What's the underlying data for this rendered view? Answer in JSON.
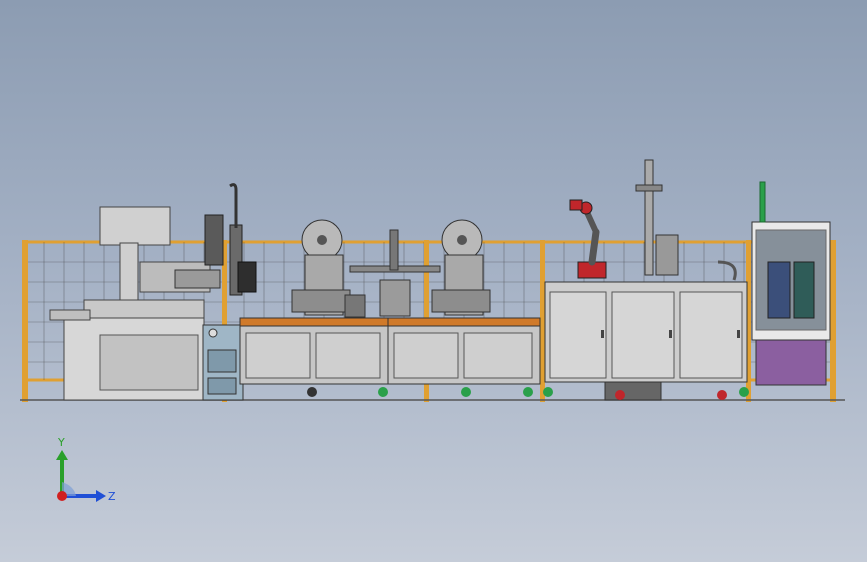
{
  "viewport": {
    "background_top": "#8c9cb2",
    "background_bottom": "#c5ccd8"
  },
  "model": {
    "fence_color": "#e0a032",
    "frame_color": "#b8b8b8",
    "cabinet_color": "#c9c9c9",
    "robot_accent": "#c0262b",
    "panel_color": "#9fb6c6",
    "purple_panel": "#8b5fa0",
    "green_accent": "#2aa04a"
  },
  "triad": {
    "y_label": "Y",
    "z_label": "Z",
    "y_color": "#2aa02a",
    "z_color": "#1f4fd6",
    "x_color": "#d02020"
  }
}
